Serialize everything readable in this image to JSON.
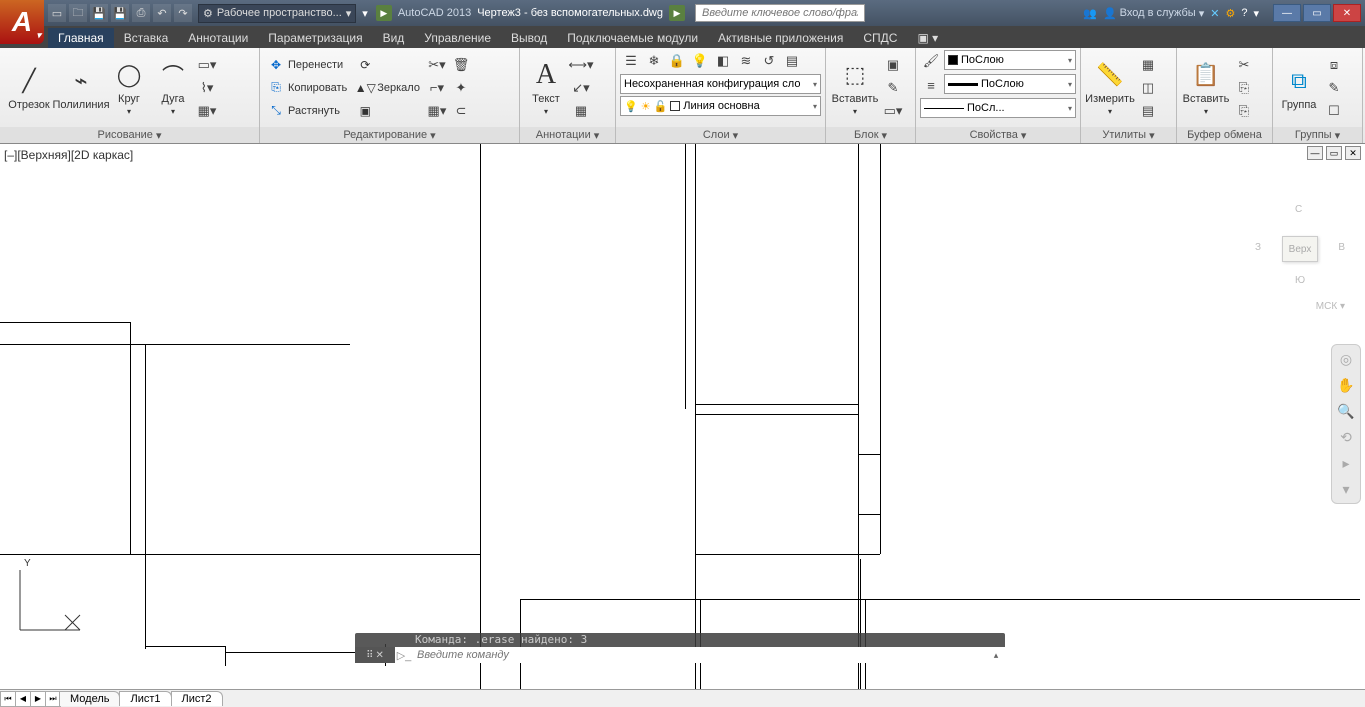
{
  "title": {
    "app": "AutoCAD 2013",
    "file": "Чертеж3 - без вспомогательных.dwg"
  },
  "workspace": "Рабочее пространство...",
  "search_placeholder": "Введите ключевое слово/фразу",
  "signin": "Вход в службы",
  "tabs": [
    "Главная",
    "Вставка",
    "Аннотации",
    "Параметризация",
    "Вид",
    "Управление",
    "Вывод",
    "Подключаемые модули",
    "Активные приложения",
    "СПДС"
  ],
  "active_tab": 0,
  "panels": {
    "draw": {
      "title": "Рисование",
      "line": "Отрезок",
      "polyline": "Полилиния",
      "circle": "Круг",
      "arc": "Дуга"
    },
    "modify": {
      "title": "Редактирование",
      "move": "Перенести",
      "copy": "Копировать",
      "stretch": "Растянуть",
      "mirror": "Зеркало"
    },
    "annot": {
      "title": "Аннотации",
      "text": "Текст"
    },
    "layers": {
      "title": "Слои",
      "config": "Несохраненная конфигурация сло",
      "current": "Линия основна"
    },
    "block": {
      "title": "Блок",
      "insert": "Вставить"
    },
    "props": {
      "title": "Свойства",
      "color": "ПоСлою",
      "lw": "ПоСлою",
      "lt": "ПоСл..."
    },
    "util": {
      "title": "Утилиты",
      "measure": "Измерить"
    },
    "clip": {
      "title": "Буфер обмена",
      "paste": "Вставить"
    },
    "group": {
      "title": "Группы",
      "group": "Группа"
    }
  },
  "view_label": "[–][Верхняя][2D каркас]",
  "viewcube": {
    "face": "Верх",
    "n": "С",
    "s": "Ю",
    "e": "В",
    "w": "З",
    "wcs": "МСК"
  },
  "cmd_history": "Команда:  .erase найдено: 3",
  "cmd_placeholder": "Введите команду",
  "bottom_tabs": [
    "Модель",
    "Лист1",
    "Лист2"
  ],
  "active_bottom": 0,
  "ucs": {
    "y": "Y"
  }
}
